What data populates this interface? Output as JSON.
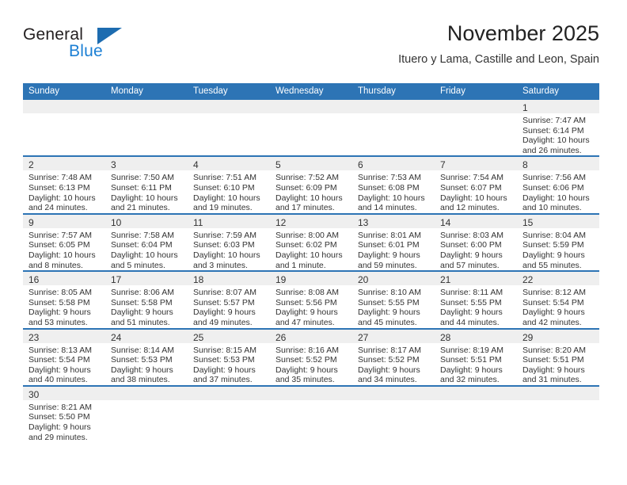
{
  "logo": {
    "word1": "General",
    "word2": "Blue",
    "flag_icon": "blue-triangle-flag-icon",
    "accent_color": "#1d6cb0"
  },
  "header": {
    "title": "November 2025",
    "location": "Ituero y Lama, Castille and Leon, Spain"
  },
  "colors": {
    "header_blue": "#2d74b5",
    "daynum_band": "#efefef",
    "text": "#333333"
  },
  "weekdays": [
    "Sunday",
    "Monday",
    "Tuesday",
    "Wednesday",
    "Thursday",
    "Friday",
    "Saturday"
  ],
  "weeks": [
    [
      {
        "day": "",
        "lines": []
      },
      {
        "day": "",
        "lines": []
      },
      {
        "day": "",
        "lines": []
      },
      {
        "day": "",
        "lines": []
      },
      {
        "day": "",
        "lines": []
      },
      {
        "day": "",
        "lines": []
      },
      {
        "day": "1",
        "lines": [
          "Sunrise: 7:47 AM",
          "Sunset: 6:14 PM",
          "Daylight: 10 hours",
          "and 26 minutes."
        ]
      }
    ],
    [
      {
        "day": "2",
        "lines": [
          "Sunrise: 7:48 AM",
          "Sunset: 6:13 PM",
          "Daylight: 10 hours",
          "and 24 minutes."
        ]
      },
      {
        "day": "3",
        "lines": [
          "Sunrise: 7:50 AM",
          "Sunset: 6:11 PM",
          "Daylight: 10 hours",
          "and 21 minutes."
        ]
      },
      {
        "day": "4",
        "lines": [
          "Sunrise: 7:51 AM",
          "Sunset: 6:10 PM",
          "Daylight: 10 hours",
          "and 19 minutes."
        ]
      },
      {
        "day": "5",
        "lines": [
          "Sunrise: 7:52 AM",
          "Sunset: 6:09 PM",
          "Daylight: 10 hours",
          "and 17 minutes."
        ]
      },
      {
        "day": "6",
        "lines": [
          "Sunrise: 7:53 AM",
          "Sunset: 6:08 PM",
          "Daylight: 10 hours",
          "and 14 minutes."
        ]
      },
      {
        "day": "7",
        "lines": [
          "Sunrise: 7:54 AM",
          "Sunset: 6:07 PM",
          "Daylight: 10 hours",
          "and 12 minutes."
        ]
      },
      {
        "day": "8",
        "lines": [
          "Sunrise: 7:56 AM",
          "Sunset: 6:06 PM",
          "Daylight: 10 hours",
          "and 10 minutes."
        ]
      }
    ],
    [
      {
        "day": "9",
        "lines": [
          "Sunrise: 7:57 AM",
          "Sunset: 6:05 PM",
          "Daylight: 10 hours",
          "and 8 minutes."
        ]
      },
      {
        "day": "10",
        "lines": [
          "Sunrise: 7:58 AM",
          "Sunset: 6:04 PM",
          "Daylight: 10 hours",
          "and 5 minutes."
        ]
      },
      {
        "day": "11",
        "lines": [
          "Sunrise: 7:59 AM",
          "Sunset: 6:03 PM",
          "Daylight: 10 hours",
          "and 3 minutes."
        ]
      },
      {
        "day": "12",
        "lines": [
          "Sunrise: 8:00 AM",
          "Sunset: 6:02 PM",
          "Daylight: 10 hours",
          "and 1 minute."
        ]
      },
      {
        "day": "13",
        "lines": [
          "Sunrise: 8:01 AM",
          "Sunset: 6:01 PM",
          "Daylight: 9 hours",
          "and 59 minutes."
        ]
      },
      {
        "day": "14",
        "lines": [
          "Sunrise: 8:03 AM",
          "Sunset: 6:00 PM",
          "Daylight: 9 hours",
          "and 57 minutes."
        ]
      },
      {
        "day": "15",
        "lines": [
          "Sunrise: 8:04 AM",
          "Sunset: 5:59 PM",
          "Daylight: 9 hours",
          "and 55 minutes."
        ]
      }
    ],
    [
      {
        "day": "16",
        "lines": [
          "Sunrise: 8:05 AM",
          "Sunset: 5:58 PM",
          "Daylight: 9 hours",
          "and 53 minutes."
        ]
      },
      {
        "day": "17",
        "lines": [
          "Sunrise: 8:06 AM",
          "Sunset: 5:58 PM",
          "Daylight: 9 hours",
          "and 51 minutes."
        ]
      },
      {
        "day": "18",
        "lines": [
          "Sunrise: 8:07 AM",
          "Sunset: 5:57 PM",
          "Daylight: 9 hours",
          "and 49 minutes."
        ]
      },
      {
        "day": "19",
        "lines": [
          "Sunrise: 8:08 AM",
          "Sunset: 5:56 PM",
          "Daylight: 9 hours",
          "and 47 minutes."
        ]
      },
      {
        "day": "20",
        "lines": [
          "Sunrise: 8:10 AM",
          "Sunset: 5:55 PM",
          "Daylight: 9 hours",
          "and 45 minutes."
        ]
      },
      {
        "day": "21",
        "lines": [
          "Sunrise: 8:11 AM",
          "Sunset: 5:55 PM",
          "Daylight: 9 hours",
          "and 44 minutes."
        ]
      },
      {
        "day": "22",
        "lines": [
          "Sunrise: 8:12 AM",
          "Sunset: 5:54 PM",
          "Daylight: 9 hours",
          "and 42 minutes."
        ]
      }
    ],
    [
      {
        "day": "23",
        "lines": [
          "Sunrise: 8:13 AM",
          "Sunset: 5:54 PM",
          "Daylight: 9 hours",
          "and 40 minutes."
        ]
      },
      {
        "day": "24",
        "lines": [
          "Sunrise: 8:14 AM",
          "Sunset: 5:53 PM",
          "Daylight: 9 hours",
          "and 38 minutes."
        ]
      },
      {
        "day": "25",
        "lines": [
          "Sunrise: 8:15 AM",
          "Sunset: 5:53 PM",
          "Daylight: 9 hours",
          "and 37 minutes."
        ]
      },
      {
        "day": "26",
        "lines": [
          "Sunrise: 8:16 AM",
          "Sunset: 5:52 PM",
          "Daylight: 9 hours",
          "and 35 minutes."
        ]
      },
      {
        "day": "27",
        "lines": [
          "Sunrise: 8:17 AM",
          "Sunset: 5:52 PM",
          "Daylight: 9 hours",
          "and 34 minutes."
        ]
      },
      {
        "day": "28",
        "lines": [
          "Sunrise: 8:19 AM",
          "Sunset: 5:51 PM",
          "Daylight: 9 hours",
          "and 32 minutes."
        ]
      },
      {
        "day": "29",
        "lines": [
          "Sunrise: 8:20 AM",
          "Sunset: 5:51 PM",
          "Daylight: 9 hours",
          "and 31 minutes."
        ]
      }
    ],
    [
      {
        "day": "30",
        "lines": [
          "Sunrise: 8:21 AM",
          "Sunset: 5:50 PM",
          "Daylight: 9 hours",
          "and 29 minutes."
        ]
      },
      {
        "day": "",
        "lines": []
      },
      {
        "day": "",
        "lines": []
      },
      {
        "day": "",
        "lines": []
      },
      {
        "day": "",
        "lines": []
      },
      {
        "day": "",
        "lines": []
      },
      {
        "day": "",
        "lines": []
      }
    ]
  ]
}
